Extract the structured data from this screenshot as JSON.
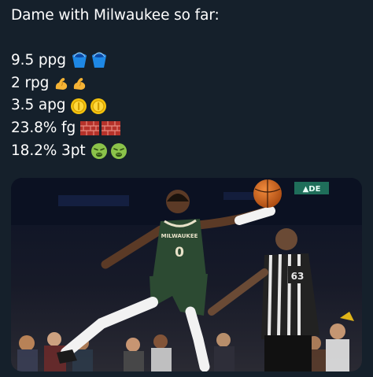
{
  "tweet": {
    "title": "Dame with Milwaukee so far:",
    "stats": [
      {
        "text": "9.5 ppg",
        "icon": "bucket-icon",
        "count": 2
      },
      {
        "text": "2 rpg",
        "icon": "flexed-biceps-icon",
        "count": 2
      },
      {
        "text": "3.5 apg",
        "icon": "coin-icon",
        "count": 2
      },
      {
        "text": "23.8% fg",
        "icon": "brick-icon",
        "count": 2
      },
      {
        "text": "18.2% 3pt",
        "icon": "nauseated-face-icon",
        "count": 2
      }
    ]
  },
  "photo": {
    "arena_sign": "▲DE",
    "jersey_team": "MILWAUKEE",
    "jersey_number": "0",
    "ref_number": "63"
  },
  "colors": {
    "background": "#15202b",
    "jersey_green": "#2c4a32",
    "ball_orange": "#d2691e"
  }
}
